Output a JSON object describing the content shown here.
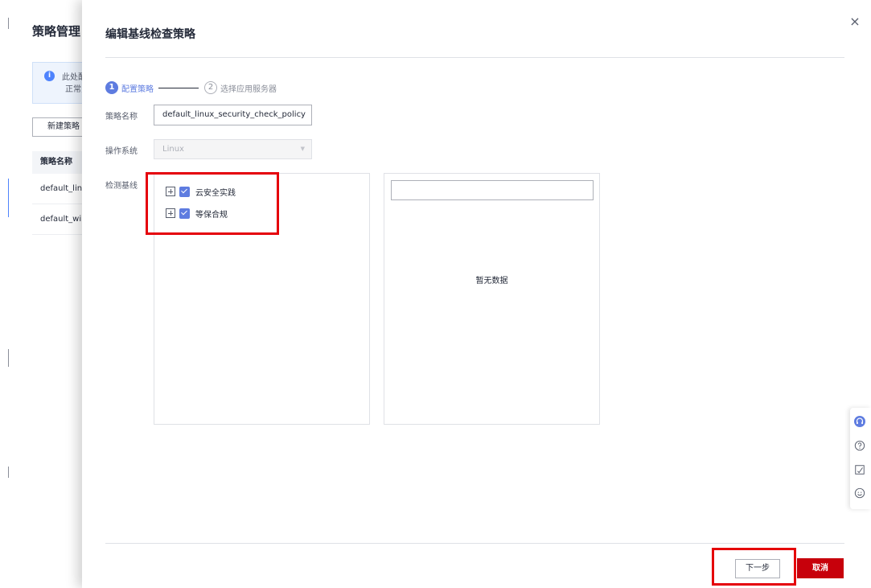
{
  "background": {
    "title": "策略管理",
    "info_line1": "此处配",
    "info_line2": "正常,",
    "new_button": "新建策略",
    "column_header": "策略名称",
    "rows": [
      "default_linu",
      "default_win"
    ]
  },
  "drawer": {
    "title": "编辑基线检查策略",
    "steps": [
      {
        "number": "1",
        "label": "配置策略",
        "active": true
      },
      {
        "number": "2",
        "label": "选择应用服务器",
        "active": false
      }
    ],
    "policy_name_label": "策略名称",
    "policy_name_value": "default_linux_security_check_policy",
    "os_label": "操作系统",
    "os_value": "Linux",
    "baseline_label": "检测基线",
    "baselines": [
      {
        "label": "云安全实践",
        "checked": true
      },
      {
        "label": "等保合规",
        "checked": true
      }
    ],
    "search_placeholder": "",
    "empty_text": "暂无数据",
    "next_button": "下一步",
    "cancel_button": "取消",
    "close_symbol": "×"
  },
  "colors": {
    "primary": "#5e7ce0",
    "danger": "#c7000b",
    "highlight": "#e5000a"
  },
  "icons": [
    "close-icon",
    "info-icon",
    "search-icon",
    "expand-icon",
    "checkbox-checked-icon",
    "headset-icon",
    "help-icon",
    "feedback-icon",
    "smile-icon"
  ]
}
